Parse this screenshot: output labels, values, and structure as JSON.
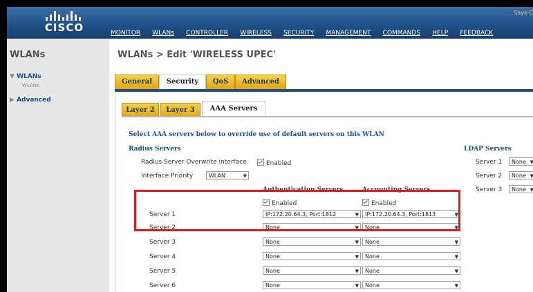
{
  "brand": "CISCO",
  "top_right": "Saye C",
  "top_menu": [
    "MONITOR",
    "WLANs",
    "CONTROLLER",
    "WIRELESS",
    "SECURITY",
    "MANAGEMENT",
    "COMMANDS",
    "HELP",
    "FEEDBACK"
  ],
  "left_nav": {
    "title": "WLANs",
    "items": [
      {
        "label": "WLANs",
        "sub": "WLANs"
      },
      {
        "label": "Advanced"
      }
    ]
  },
  "page_title": "WLANs > Edit  'WIRELESS UPEC'",
  "tabs": [
    "General",
    "Security",
    "QoS",
    "Advanced"
  ],
  "active_tab": "Security",
  "subtabs": [
    "Layer 2",
    "Layer 3",
    "AAA Servers"
  ],
  "active_subtab": "AAA Servers",
  "intro": "Select AAA servers below to override use of default servers on this WLAN",
  "radius": {
    "title": "Radius Servers",
    "overwrite_label": "Radius Server Overwrite interface",
    "overwrite_value": "Enabled",
    "priority_label": "Interface Priority",
    "priority_value": "WLAN",
    "auth_header": "Authentication Servers",
    "acct_header": "Accounting Servers",
    "auth_enabled": "Enabled",
    "acct_enabled": "Enabled",
    "servers": [
      {
        "label": "Server 1",
        "auth": "IP:172.20.64.3, Port:1812",
        "acct": "IP:172.20.64.3, Port:1813"
      },
      {
        "label": "Server 2",
        "auth": "None",
        "acct": "None"
      },
      {
        "label": "Server 3",
        "auth": "None",
        "acct": "None"
      },
      {
        "label": "Server 4",
        "auth": "None",
        "acct": "None"
      },
      {
        "label": "Server 5",
        "auth": "None",
        "acct": "None"
      },
      {
        "label": "Server 6",
        "auth": "None",
        "acct": "None"
      }
    ]
  },
  "ldap": {
    "title": "LDAP Servers",
    "servers": [
      {
        "label": "Server 1",
        "value": "None"
      },
      {
        "label": "Server 2",
        "value": "None"
      },
      {
        "label": "Server 3",
        "value": "None"
      }
    ]
  },
  "colors": {
    "topbar": "#1e4f86",
    "tab_gold": "#e6a514",
    "highlight": "#e11b1b",
    "link_blue": "#1b4f86"
  }
}
